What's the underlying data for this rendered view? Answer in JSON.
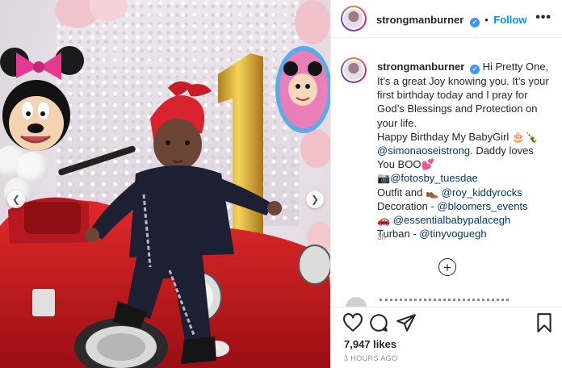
{
  "post": {
    "username": "strongmanburner",
    "follow_label": "Follow",
    "caption": {
      "username": "strongmanburner",
      "l1": "Hi Pretty One,",
      "l2": "It’s a great Joy knowing you. It’s your",
      "l3": "first birthday today and I pray for",
      "l4": "God’s Blessings and Protection on",
      "l5": "your life.",
      "l6": "Happy Birthday My BabyGirl 🎂🍾",
      "mention1": "@simonaoseistrong",
      "l7_rest": ". Daddy loves",
      "l8": "You BOO💕",
      "l9_emoji": "📷",
      "mention2": "@fotosby_tuesdae",
      "l10_prefix": "Outfit and 👞",
      "mention3": "@roy_kiddyrocks",
      "l11_prefix": "Decoration - ",
      "mention4": "@bloomers_events",
      "l12_prefix": "🚗",
      "mention5": "@essentialbabypalacegh",
      "l13_prefix": "Turban - ",
      "mention6": "@tinyvoguegh"
    },
    "caption_time": "3h",
    "likes": "7,947 likes",
    "posted": "3 HOURS AGO"
  },
  "icons": {
    "verified": "verified-badge",
    "more": "more-horizontal",
    "add": "plus-circle",
    "like": "heart",
    "comment": "speech-bubble",
    "share": "paper-plane",
    "save": "bookmark"
  },
  "colors": {
    "link": "#0095f6",
    "mention": "#00376b",
    "verified": "#3897f0",
    "muted": "#8e8e8e",
    "border": "#efefef"
  }
}
